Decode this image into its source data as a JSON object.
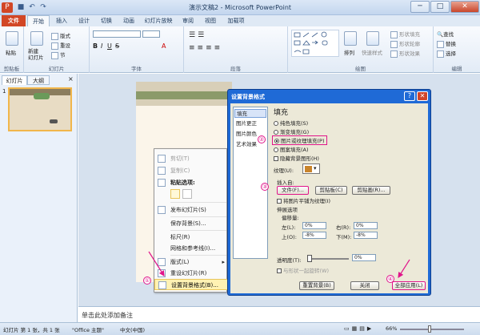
{
  "window": {
    "title": "演示文稿2 - Microsoft PowerPoint",
    "controls": {
      "minimize": "─",
      "maximize": "□",
      "close": "✕"
    },
    "qat": {
      "app": "P",
      "save": "■",
      "undo": "↶",
      "redo": "↷"
    }
  },
  "tabs": [
    "文件",
    "开始",
    "插入",
    "设计",
    "切换",
    "动画",
    "幻灯片放映",
    "审阅",
    "视图",
    "加载项"
  ],
  "ribbon": {
    "groups": {
      "clipboard": {
        "label": "剪贴板",
        "paste": "粘贴"
      },
      "slides": {
        "label": "幻灯片",
        "new_slide": "新建\n幻灯片",
        "layout": "版式",
        "reset": "重设",
        "section": "节"
      },
      "font": {
        "label": "字体"
      },
      "paragraph": {
        "label": "段落"
      },
      "drawing": {
        "label": "绘图",
        "arrange": "排列",
        "quick_styles": "快速样式",
        "fill": "形状填充",
        "outline": "形状轮廓",
        "effects": "形状效果"
      },
      "editing": {
        "label": "编辑",
        "find": "查找",
        "replace": "替换",
        "select": "选择"
      }
    }
  },
  "left_panel": {
    "tab_slides": "幻灯片",
    "tab_outline": "大纲",
    "slide_number": "1",
    "close": "×"
  },
  "context_menu": {
    "items": [
      {
        "label": "剪切(T)",
        "disabled": true
      },
      {
        "label": "复制(C)",
        "disabled": true
      },
      {
        "label": "粘贴选项:",
        "disabled": false
      },
      {
        "label": "发布幻灯片(S)",
        "disabled": false
      },
      {
        "label": "保存背景(S)...",
        "disabled": false
      },
      {
        "label": "标尺(R)",
        "disabled": false
      },
      {
        "label": "网格和参考线(I)...",
        "disabled": false
      },
      {
        "label": "版式(L)",
        "disabled": false
      },
      {
        "label": "重设幻灯片(R)",
        "disabled": false
      },
      {
        "label": "设置背景格式(B)...",
        "disabled": false
      }
    ]
  },
  "dialog": {
    "title": "设置背景格式",
    "help": "?",
    "close": "✕",
    "categories": [
      "填充",
      "图片更正",
      "图片颜色",
      "艺术效果"
    ],
    "section_title": "填充",
    "fill_options": [
      {
        "label": "纯色填充(S)",
        "checked": false
      },
      {
        "label": "渐变填充(G)",
        "checked": false
      },
      {
        "label": "图片或纹理填充(P)",
        "checked": true
      },
      {
        "label": "图案填充(A)",
        "checked": false
      }
    ],
    "hide_bg": "隐藏背景图形(H)",
    "texture_label": "纹理(U):",
    "insert_from": "插入自:",
    "btn_file": "文件(F)...",
    "btn_clipboard": "剪贴板(C)",
    "btn_clipart": "剪贴画(R)...",
    "tile_label": "将图片平铺为纹理(I)",
    "stretch_label": "伸展选项",
    "offset_label": "偏移量:",
    "left_label": "左(L):",
    "left_val": "0%",
    "right_label": "右(R):",
    "right_val": "0%",
    "top_label": "上(O):",
    "top_val": "-8%",
    "bottom_label": "下(M):",
    "bottom_val": "-8%",
    "transparency_label": "透明度(T):",
    "transparency_val": "0%",
    "rotate_label": "与形状一起旋转(W)",
    "btn_reset": "重置背景(B)",
    "btn_close": "关闭",
    "btn_apply_all": "全部应用(L)"
  },
  "annotations": [
    "①",
    "②",
    "③",
    "④"
  ],
  "notes_placeholder": "单击此处添加备注",
  "status": {
    "slide": "幻灯片 第 1 张，共 1 张",
    "theme": "\"Office 主题\"",
    "lang": "中文(中国)",
    "zoom": "66%"
  },
  "colors": {
    "file_tab": "#d24726",
    "dialog_title": "#1f6ad6",
    "annotation": "#e0158a",
    "highlight": "#fff2b3"
  }
}
